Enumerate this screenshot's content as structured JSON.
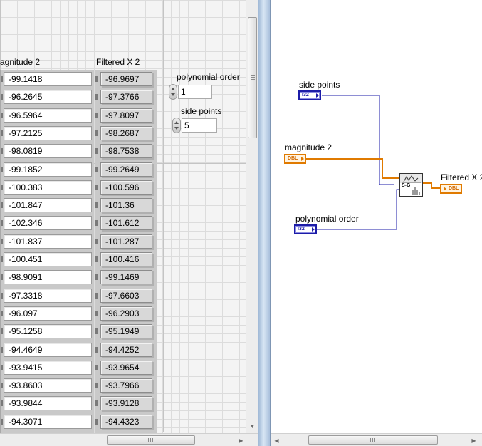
{
  "front_panel": {
    "magnitude_array": {
      "label": "agnitude 2",
      "values": [
        "-99.1418",
        "-96.2645",
        "-96.5964",
        "-97.2125",
        "-98.0819",
        "-99.1852",
        "-100.383",
        "-101.847",
        "-102.346",
        "-101.837",
        "-100.451",
        "-98.9091",
        "-97.3318",
        "-96.097",
        "-95.1258",
        "-94.4649",
        "-93.9415",
        "-93.8603",
        "-93.9844",
        "-94.3071"
      ]
    },
    "filtered_array": {
      "label": "Filtered X 2",
      "values": [
        "-96.9697",
        "-97.3766",
        "-97.8097",
        "-98.2687",
        "-98.7538",
        "-99.2649",
        "-100.596",
        "-101.36",
        "-101.612",
        "-101.287",
        "-100.416",
        "-99.1469",
        "-97.6603",
        "-96.2903",
        "-95.1949",
        "-94.4252",
        "-93.9654",
        "-93.7966",
        "-93.9128",
        "-94.4323"
      ]
    },
    "polynomial_order": {
      "label": "polynomial order",
      "value": "1"
    },
    "side_points": {
      "label": "side points",
      "value": "5"
    },
    "context_menu_icon": "hamburger-icon"
  },
  "block_diagram": {
    "side_points_label": "side points",
    "side_points_type": "I32",
    "magnitude_label": "magnitude 2",
    "magnitude_type": "DBL",
    "polynomial_label": "polynomial order",
    "polynomial_type": "I32",
    "output_label": "Filtered X 2",
    "output_type": "DBL",
    "vi_icon": "savitzky-golay-filter-icon",
    "vi_text": "S-G",
    "colors": {
      "i32": "#1c1ca8",
      "dbl": "#e07a00"
    }
  }
}
